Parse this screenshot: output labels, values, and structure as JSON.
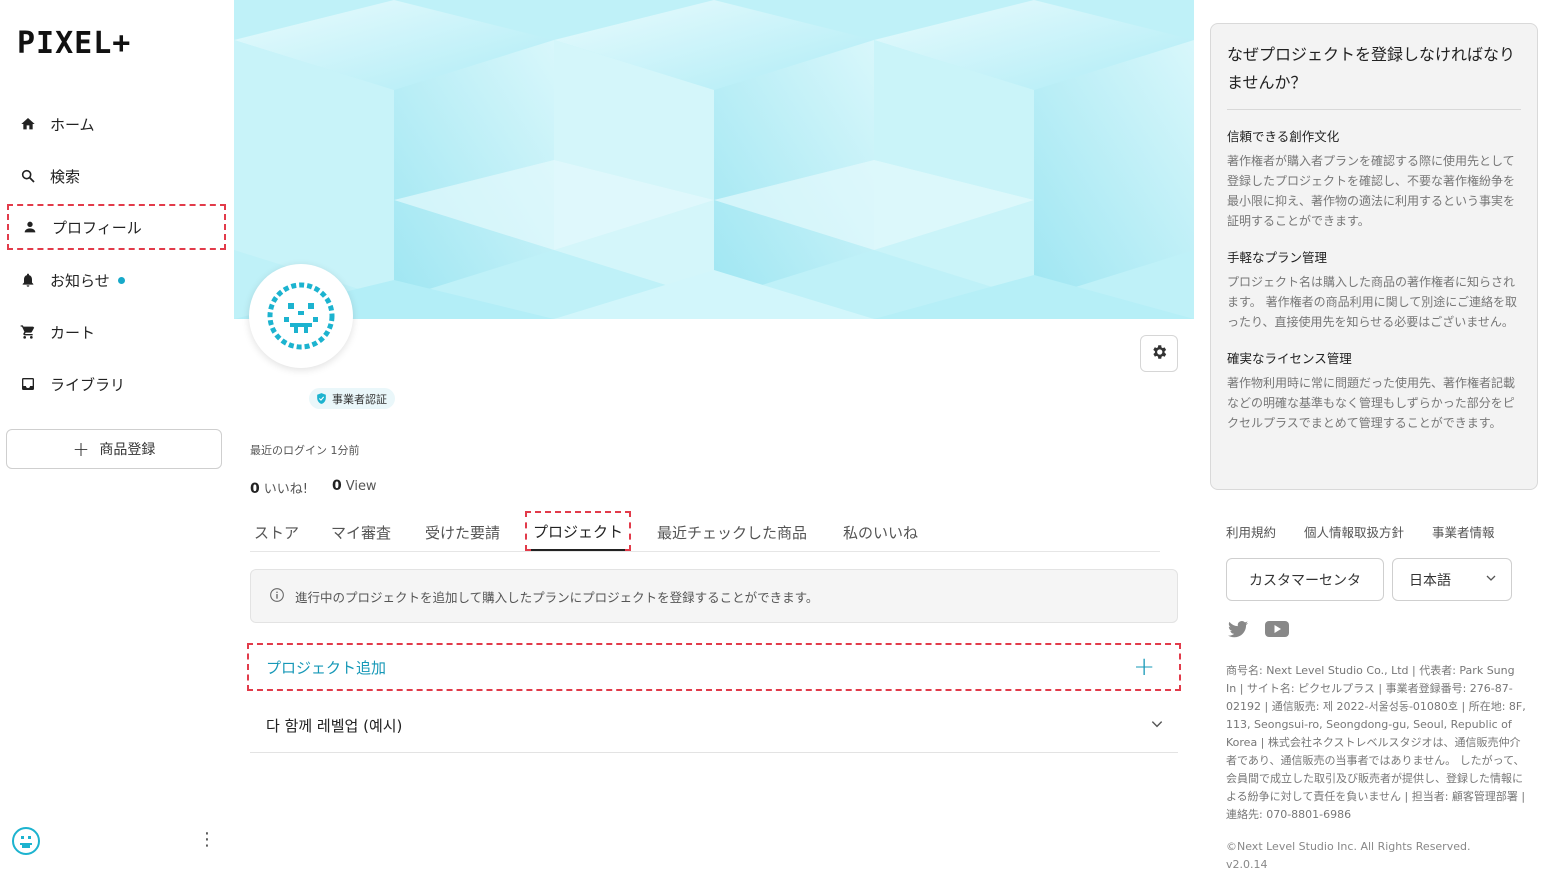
{
  "brand": {
    "logo_text": "PIXEL+",
    "accent": "#1698b7"
  },
  "sidebar": {
    "items": [
      {
        "label": "ホーム",
        "icon": "home-icon"
      },
      {
        "label": "検索",
        "icon": "search-icon"
      },
      {
        "label": "プロフィール",
        "icon": "person-icon"
      },
      {
        "label": "お知らせ",
        "icon": "bell-icon"
      },
      {
        "label": "カート",
        "icon": "cart-icon"
      },
      {
        "label": "ライブラリ",
        "icon": "library-icon"
      }
    ],
    "add_product_label": "商品登録"
  },
  "profile": {
    "badge": "事業者認証",
    "last_login": "最近のログイン 1分前",
    "likes_count": "0",
    "likes_label": "いいね!",
    "views_count": "0",
    "views_label": "View"
  },
  "tabs": [
    {
      "label": "ストア"
    },
    {
      "label": "マイ審査"
    },
    {
      "label": "受けた要請"
    },
    {
      "label": "プロジェクト"
    },
    {
      "label": "最近チェックした商品"
    },
    {
      "label": "私のいいね"
    }
  ],
  "info_text": "進行中のプロジェクトを追加して購入したプランにプロジェクトを登録することができます。",
  "add_project_label": "プロジェクト追加",
  "project_item": "다 함께 레벨업 (예시)",
  "why": {
    "title": "なぜプロジェクトを登録しなければなりませんか？",
    "sections": [
      {
        "heading": "信頼できる創作文化",
        "body": "著作権者が購入者プランを確認する際に使用先として登録したプロジェクトを確認し、不要な著作権紛争を最小限に抑え、著作物の適法に利用するという事実を証明することができます。"
      },
      {
        "heading": "手軽なプラン管理",
        "body": "プロジェクト名は購入した商品の著作権者に知らされます。 著作権者の商品利用に関して別途にご連絡を取ったり、直接使用先を知らせる必要はございません。"
      },
      {
        "heading": "確実なライセンス管理",
        "body": "著作物利用時に常に問題だった使用先、著作権者記載などの明確な基準もなく管理もしずらかった部分をピクセルプラスでまとめて管理することができます。"
      }
    ]
  },
  "footer": {
    "links": [
      "利用規約",
      "個人情報取扱方針",
      "事業者情報"
    ],
    "customer_center": "カスタマーセンタ",
    "language": "日本語",
    "company_info": "商号名: Next Level Studio Co., Ltd | 代表者: Park Sung In | サイト名: ピクセルプラス | 事業者登録番号: 276-87-02192 | 通信販売: 제 2022-서울성동-01080호 | 所在地: 8F, 113, Seongsui-ro, Seongdong-gu, Seoul, Republic of Korea | 株式会社ネクストレベルスタジオは、通信販売仲介者であり、通信販売の当事者ではありません。 したがって、会員間で成立した取引及び販売者が提供し、登録した情報による紛争に対して責任を負いません | 担当者: 顧客管理部署 | 連絡先: 070-8801-6986",
    "copyright": "©Next Level Studio Inc. All Rights Reserved.",
    "version": "v2.0.14"
  }
}
